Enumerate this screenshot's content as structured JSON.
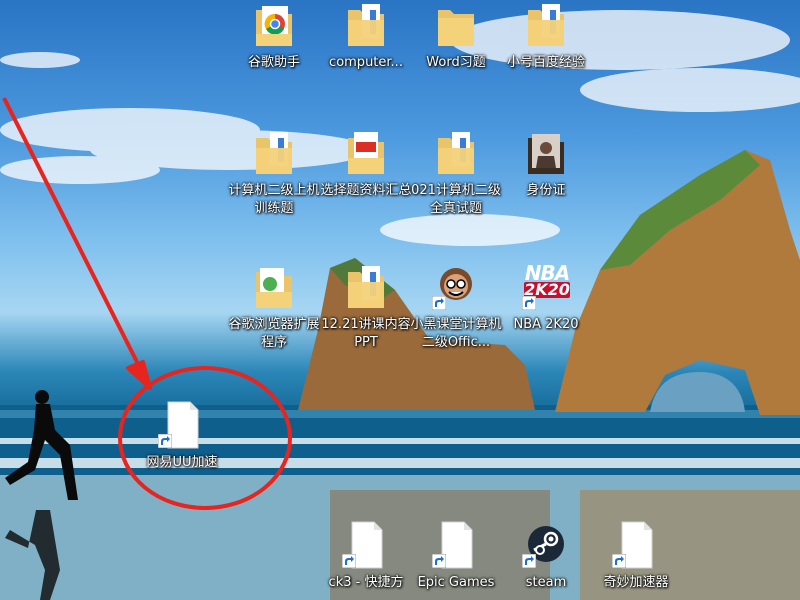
{
  "desktop": {
    "icons": [
      {
        "label": "谷歌助手",
        "type": "folder-chrome",
        "shortcut": false
      },
      {
        "label": "computer...",
        "type": "folder-doc",
        "shortcut": false
      },
      {
        "label": "Word习题",
        "type": "folder",
        "shortcut": false
      },
      {
        "label": "小号百度经验",
        "type": "folder-doc",
        "shortcut": false
      },
      {
        "label": "计算机二级上机训练题",
        "type": "folder-doc",
        "shortcut": false
      },
      {
        "label": "选择题资料汇总",
        "type": "folder-pdf",
        "shortcut": false
      },
      {
        "label": "021计算机二级全真试题",
        "type": "folder-doc",
        "shortcut": false
      },
      {
        "label": "身份证",
        "type": "folder-photo",
        "shortcut": false
      },
      {
        "label": "谷歌浏览器扩展程序",
        "type": "folder-green",
        "shortcut": false
      },
      {
        "label": "12.21讲课内容PPT",
        "type": "folder-doc",
        "shortcut": false
      },
      {
        "label": "小黑课堂计算机二级Offic...",
        "type": "avatar",
        "shortcut": true
      },
      {
        "label": "NBA 2K20",
        "type": "nba",
        "shortcut": true
      },
      {
        "label": "网易UU加速",
        "type": "file",
        "shortcut": true
      },
      {
        "label": "ck3 - 快捷方",
        "type": "file",
        "shortcut": true
      },
      {
        "label": "Epic Games",
        "type": "file",
        "shortcut": true
      },
      {
        "label": "steam",
        "type": "steam",
        "shortcut": true
      },
      {
        "label": "奇妙加速器",
        "type": "file",
        "shortcut": true
      }
    ],
    "nba_logo": {
      "line1": "NBA",
      "line2": "2K20"
    }
  },
  "annotation": {
    "color": "#e8241e"
  }
}
